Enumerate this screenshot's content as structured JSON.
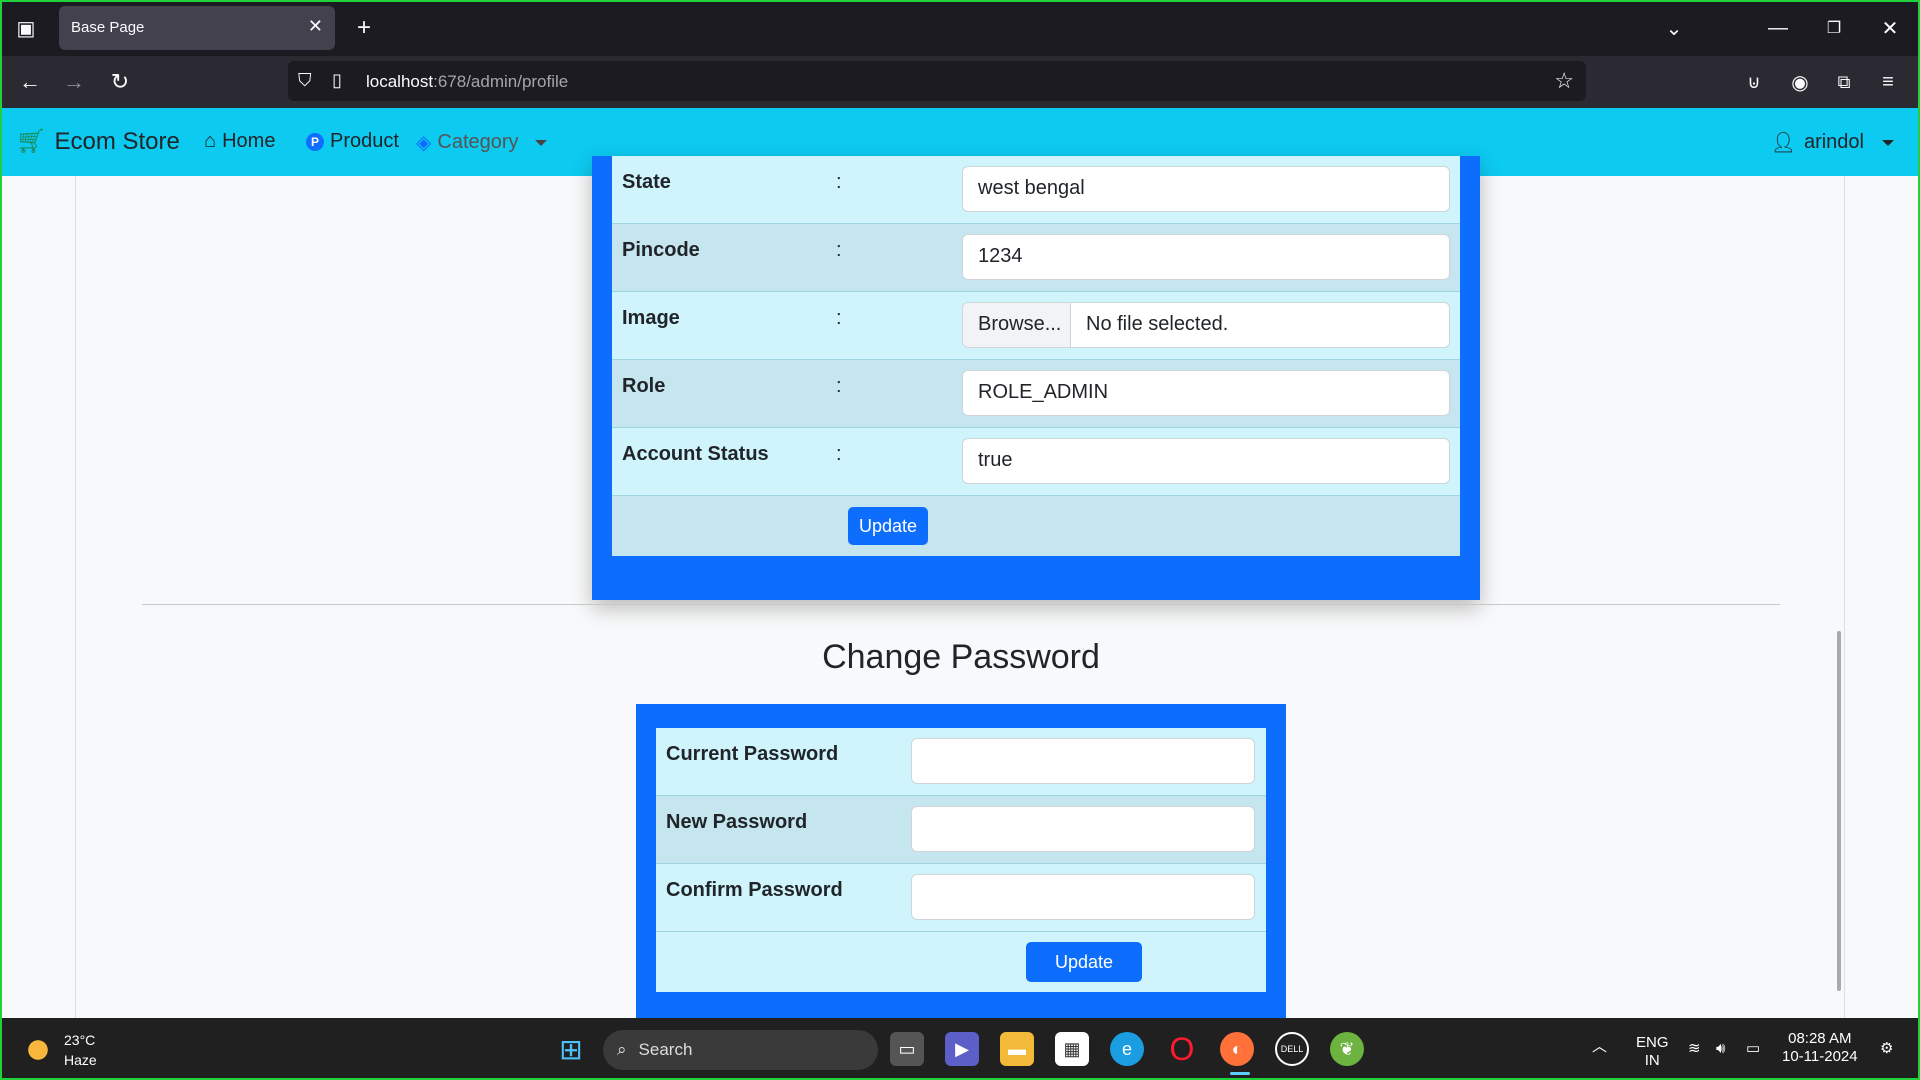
{
  "browser": {
    "tab_title": "Base Page",
    "url_host": "localhost",
    "url_path": ":678/admin/profile"
  },
  "navbar": {
    "brand": "Ecom Store",
    "home": "Home",
    "product": "Product",
    "category": "Category",
    "user": "arindol"
  },
  "profile": {
    "rows": [
      {
        "label": "State",
        "value": "west bengal"
      },
      {
        "label": "Pincode",
        "value": "1234"
      },
      {
        "label": "Image",
        "browse": "Browse...",
        "value": "No file selected."
      },
      {
        "label": "Role",
        "value": "ROLE_ADMIN"
      },
      {
        "label": "Account Status",
        "value": "true"
      }
    ],
    "colon": ":",
    "update_label": "Update"
  },
  "change_password": {
    "title": "Change Password",
    "current_label": "Current Password",
    "new_label": "New Password",
    "confirm_label": "Confirm Password",
    "update_label": "Update"
  },
  "taskbar": {
    "temperature": "23°C",
    "weather": "Haze",
    "search_placeholder": "Search",
    "language": "ENG",
    "region": "IN",
    "time": "08:28 AM",
    "date": "10-11-2024"
  }
}
